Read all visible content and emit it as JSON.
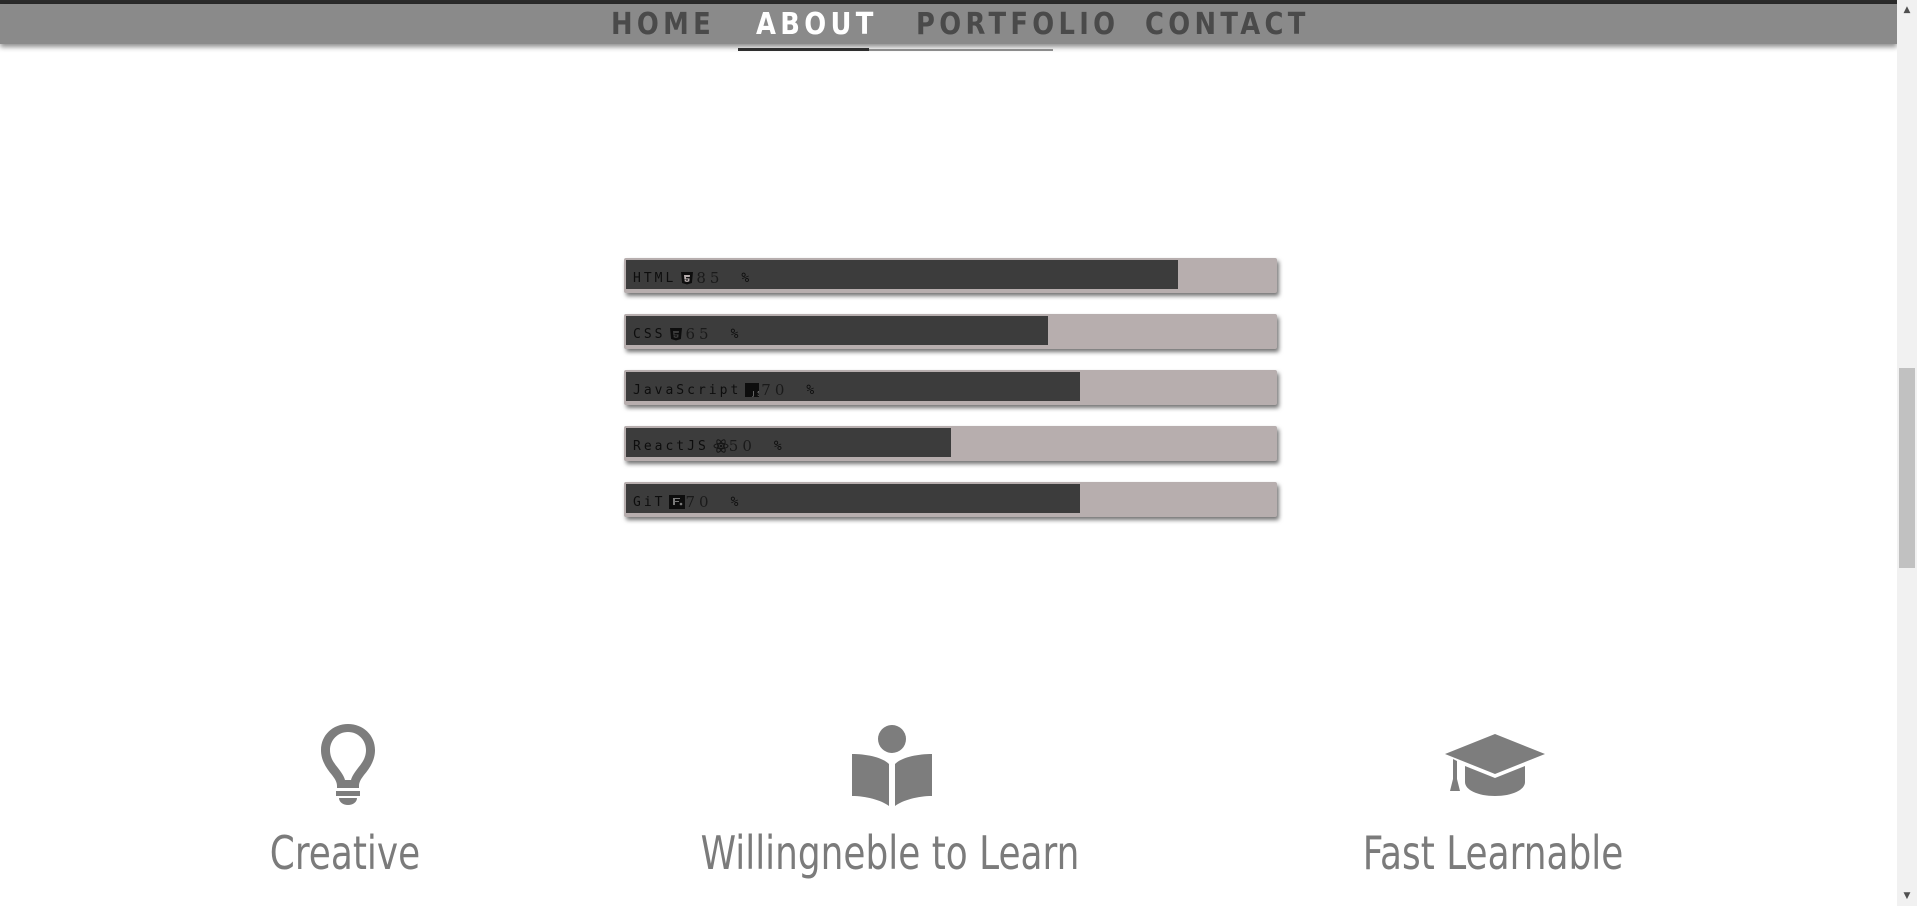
{
  "nav": {
    "items": [
      {
        "label": "HOME"
      },
      {
        "label": "ABOUT"
      },
      {
        "label": "PORTFOLIO"
      },
      {
        "label": "CONTACT"
      }
    ],
    "active": "ABOUT"
  },
  "skills": [
    {
      "name": "HTML",
      "icon": "html5-icon",
      "percent": "85",
      "sign": "%",
      "level": 0.85
    },
    {
      "name": "CSS",
      "icon": "css3-icon",
      "percent": "65",
      "sign": "%",
      "level": 0.65
    },
    {
      "name": "JavaScript",
      "icon": "javascript-icon",
      "percent": "70",
      "sign": "%",
      "level": 0.7
    },
    {
      "name": "ReactJS",
      "icon": "react-icon",
      "percent": "50",
      "sign": "%",
      "level": 0.5
    },
    {
      "name": "GiT",
      "icon": "git-icon",
      "percent": "70",
      "sign": "%",
      "level": 0.7
    }
  ],
  "features": [
    {
      "title": "Creative",
      "icon": "lightbulb-icon"
    },
    {
      "title": "Willingneble to Learn",
      "icon": "reading-person-icon"
    },
    {
      "title": "Fast Learnable",
      "icon": "graduation-cap-icon"
    }
  ],
  "colors": {
    "nav_bg": "#8a8a8a",
    "nav_text": "#4a4a4a",
    "nav_active": "#ffffff",
    "skill_track": "#b7aeae",
    "skill_fill": "#3c3c3c",
    "feature_text": "#7b7b7b"
  }
}
